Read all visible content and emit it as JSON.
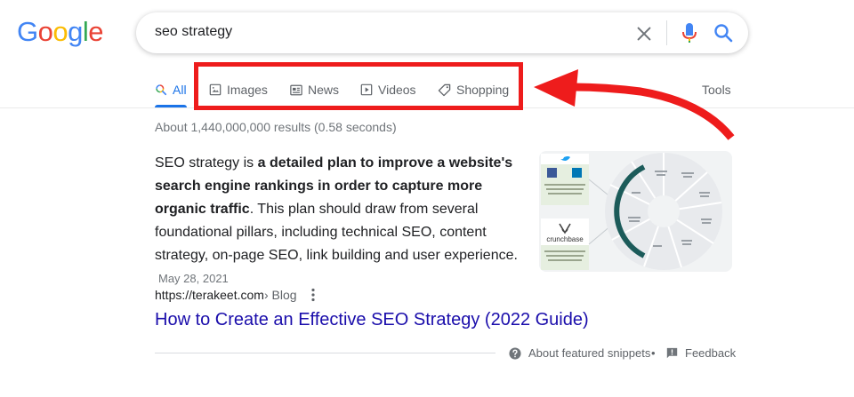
{
  "logo": {
    "letters": [
      "G",
      "o",
      "o",
      "g",
      "l",
      "e"
    ],
    "colors": [
      "#4285F4",
      "#EA4335",
      "#FBBC05",
      "#4285F4",
      "#34A853",
      "#EA4335"
    ]
  },
  "search": {
    "query": "seo strategy"
  },
  "tabs": {
    "all": "All",
    "images": "Images",
    "news": "News",
    "videos": "Videos",
    "shopping": "Shopping",
    "tools": "Tools"
  },
  "results": {
    "count": "About 1,440,000,000 results (0.58 seconds)"
  },
  "snippet": {
    "intro": "SEO strategy is ",
    "bold": "a detailed plan to improve a website's search engine rankings in order to capture more organic traffic",
    "rest": ". This plan should draw from several foundational pillars, including technical SEO, content strategy, on-page SEO, link building and user experience.",
    "date": "May 28, 2021",
    "image_labels": {
      "brand": "crunchbase"
    }
  },
  "source": {
    "url": "https://terakeet.com",
    "crumb": " › Blog"
  },
  "result": {
    "title": "How to Create an Effective SEO Strategy (2022 Guide)"
  },
  "footer": {
    "about": "About featured snippets",
    "separator": "•",
    "feedback": "Feedback"
  },
  "colors": {
    "accent_blue": "#1a73e8",
    "link_blue": "#1a0dab",
    "highlight_red": "#ee1c1c"
  }
}
